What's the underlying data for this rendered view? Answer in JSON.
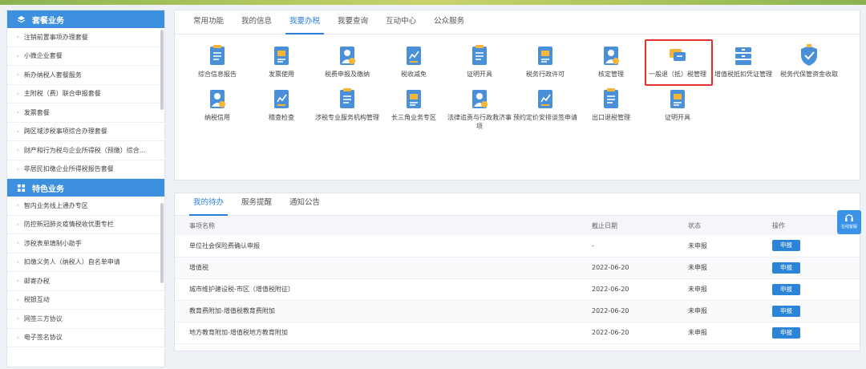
{
  "sidebar": {
    "section1": {
      "title": "套餐业务",
      "items": [
        "注销前置事项办理套餐",
        "小微企业套餐",
        "新办纳税人套餐服务",
        "主附税（费）联合申报套餐",
        "发票套餐",
        "跨区域涉税事项综合办理套餐",
        "财产和行为税与企业所得税（预缴）综合...",
        "非居民扣缴企业所得税报告套餐"
      ]
    },
    "section2": {
      "title": "特色业务",
      "items": [
        "智内业务线上通办专区",
        "防控新冠肺炎疫情税收优惠专栏",
        "涉税表单填制小助手",
        "扣缴义务人（纳税人）自名单申请",
        "邮寄办税",
        "税银互动",
        "网签三方协议",
        "电子签名协议"
      ]
    }
  },
  "top_tabs": [
    "常用功能",
    "我的信息",
    "我要办税",
    "我要查询",
    "互动中心",
    "公众服务"
  ],
  "top_active_tab": "我要办税",
  "services_row1": [
    {
      "label": "综合信息报告",
      "icon": "report-icon"
    },
    {
      "label": "发票使用",
      "icon": "invoice-icon"
    },
    {
      "label": "税费申报及缴纳",
      "icon": "tax-declare-icon"
    },
    {
      "label": "税收减免",
      "icon": "tax-relief-icon"
    },
    {
      "label": "证明开具",
      "icon": "certificate-icon"
    },
    {
      "label": "税务行政许可",
      "icon": "permit-icon"
    },
    {
      "label": "核定管理",
      "icon": "assess-icon"
    },
    {
      "label": "一般退（抵）税管理",
      "icon": "refund-icon"
    },
    {
      "label": "增值税抵扣凭证管理",
      "icon": "vat-deduct-icon"
    },
    {
      "label": "税务代保管资金收取",
      "icon": "custody-icon"
    }
  ],
  "services_row2": [
    {
      "label": "纳税信用",
      "icon": "credit-icon"
    },
    {
      "label": "稽查检查",
      "icon": "inspection-icon"
    },
    {
      "label": "涉税专业服务机构管理",
      "icon": "agency-icon"
    },
    {
      "label": "长三角业务专区",
      "icon": "yangtze-icon"
    },
    {
      "label": "法律追责与行政救济事项",
      "icon": "legal-icon"
    },
    {
      "label": "预约定价安排谈签申请",
      "icon": "pricing-icon"
    },
    {
      "label": "出口退税管理",
      "icon": "export-refund-icon"
    },
    {
      "label": "证明开具",
      "icon": "certificate2-icon"
    }
  ],
  "bottom_tabs": [
    "我的待办",
    "服务提醒",
    "通知公告"
  ],
  "bottom_active_tab": "我的待办",
  "table": {
    "headers": [
      "事项名称",
      "截止日期",
      "状态",
      "操作"
    ],
    "rows": [
      {
        "name": "单位社会保险费确认申报",
        "date": "-",
        "status": "未申报",
        "action": "申报"
      },
      {
        "name": "增值税",
        "date": "2022-06-20",
        "status": "未申报",
        "action": "申报"
      },
      {
        "name": "城市维护建设税-市区（增值税附征）",
        "date": "2022-06-20",
        "status": "未申报",
        "action": "申报"
      },
      {
        "name": "教育费附加-增值税教育费附加",
        "date": "2022-06-20",
        "status": "未申报",
        "action": "申报"
      },
      {
        "name": "地方教育附加-增值税地方教育附加",
        "date": "2022-06-20",
        "status": "未申报",
        "action": "申报"
      }
    ]
  },
  "float_button": "在线客服",
  "colors": {
    "accent": "#2c7fd8",
    "sidebar_header": "#3d8fe0",
    "highlight": "#e0322d",
    "icon_blue": "#4a90d9",
    "icon_yellow": "#f5b537"
  }
}
